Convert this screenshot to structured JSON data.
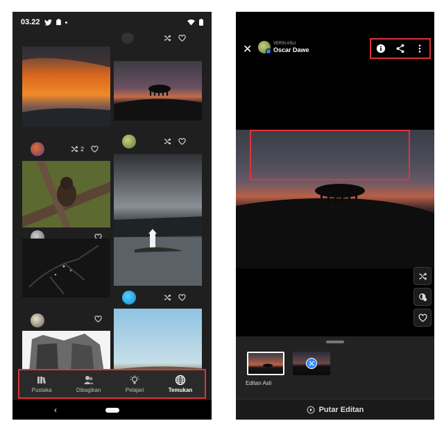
{
  "left_phone": {
    "status": {
      "time": "03.22"
    },
    "cards": [
      {
        "name": "sunset-card",
        "remix_count": "2"
      }
    ],
    "nav": [
      {
        "label": "Pustaka",
        "icon": "library-icon",
        "active": false
      },
      {
        "label": "Dibagikan",
        "icon": "shared-people-icon",
        "active": false
      },
      {
        "label": "Pelajari",
        "icon": "lightbulb-icon",
        "active": false
      },
      {
        "label": "Temukan",
        "icon": "globe-icon",
        "active": true
      }
    ]
  },
  "right_phone": {
    "author": {
      "label": "VERSI ASLI",
      "name": "Oscar Dawe"
    },
    "top_actions": [
      "info-icon",
      "share-icon",
      "more-vertical-icon"
    ],
    "side_actions": [
      "remix-icon",
      "apply-preset-icon",
      "heart-icon"
    ],
    "versions": [
      {
        "label": "Editan Asli",
        "selected": true
      },
      {
        "label": "",
        "selected": false,
        "icon": "remix-icon"
      }
    ],
    "play_label": "Putar Editan"
  },
  "colors": {
    "highlight": "#e0333a",
    "accent": "#2d8cff"
  }
}
